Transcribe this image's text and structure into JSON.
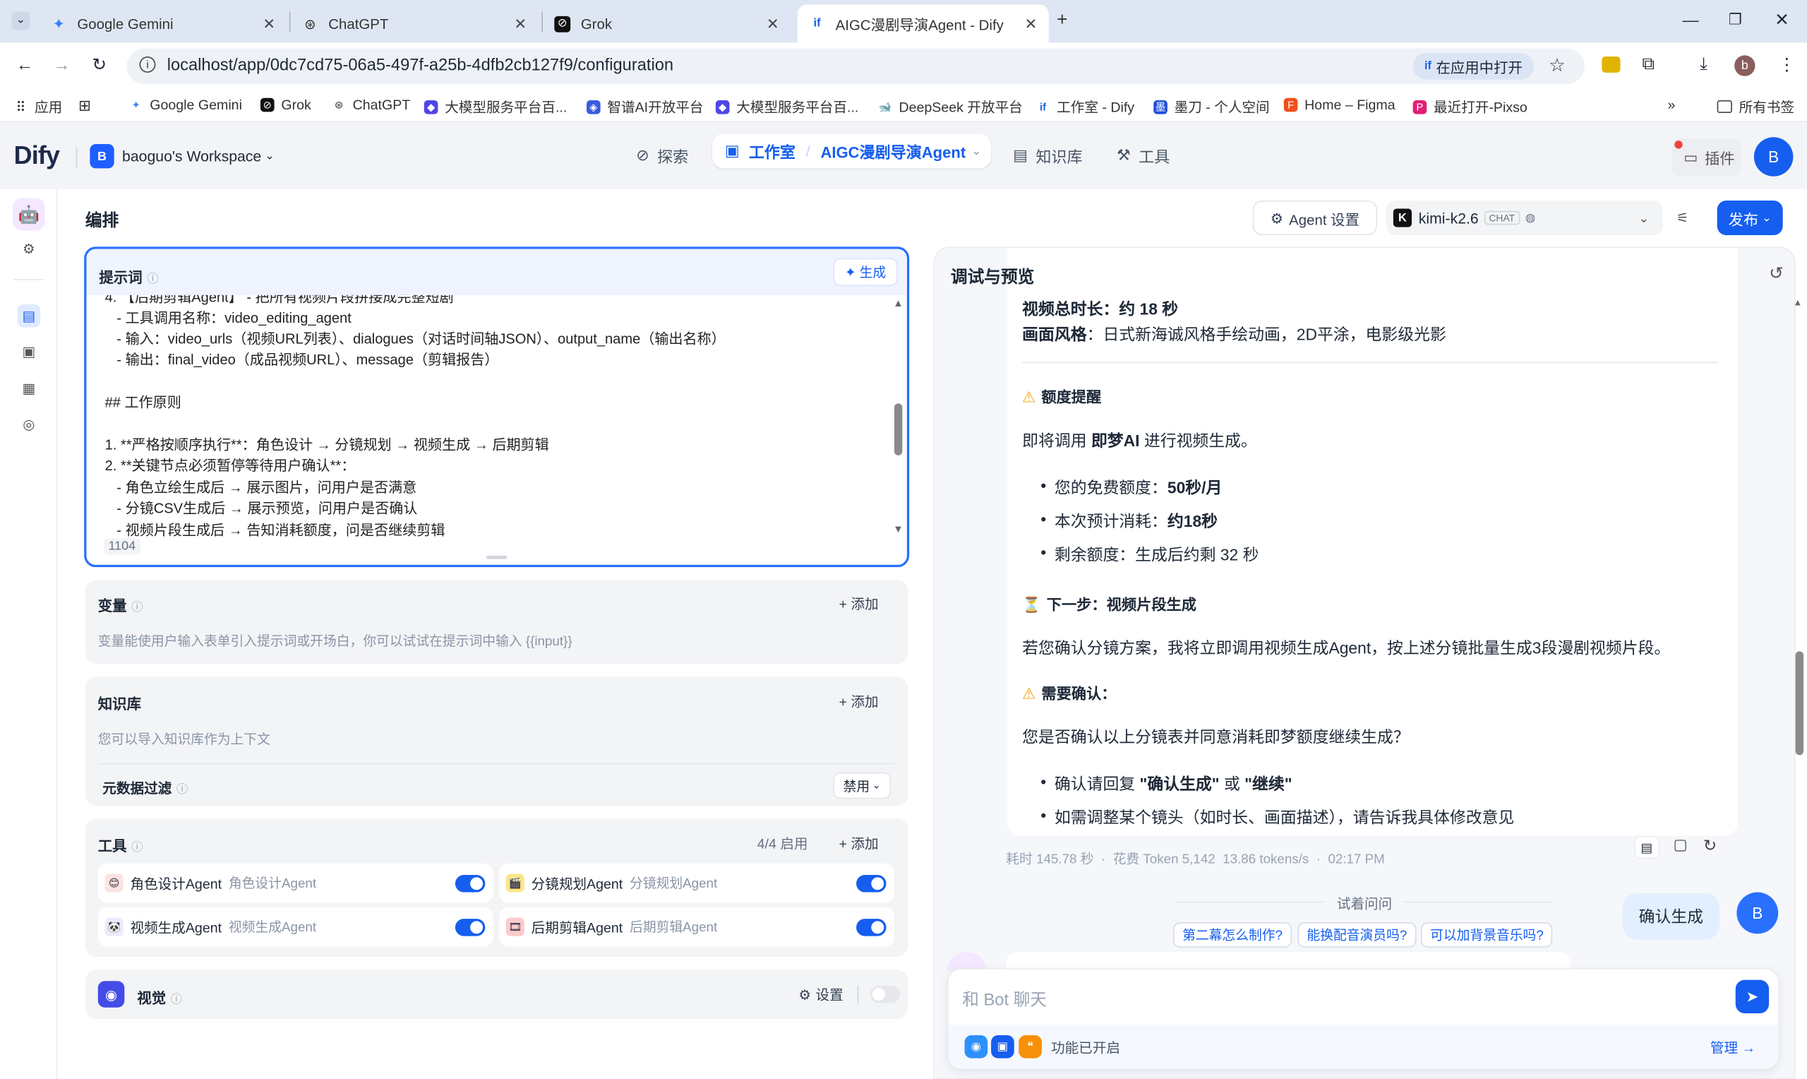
{
  "browser": {
    "tabs": [
      {
        "title": "Google Gemini"
      },
      {
        "title": "ChatGPT"
      },
      {
        "title": "Grok"
      },
      {
        "title": "AIGC漫剧导演Agent - Dify"
      }
    ],
    "url": "localhost/app/0dc7cd75-06a5-497f-a25b-4dfb2cb127f9/configuration",
    "open_in_app": "在应用中打开",
    "profile_initial": "b",
    "bookmarks": [
      "应用",
      "Google Gemini",
      "Grok",
      "ChatGPT",
      "大模型服务平台百...",
      "智谱AI开放平台",
      "大模型服务平台百...",
      "DeepSeek 开放平台",
      "工作室 - Dify",
      "墨刀 - 个人空间",
      "Home – Figma",
      "最近打开-Pixso"
    ],
    "all_bookmarks": "所有书签"
  },
  "app": {
    "logo": "Dify",
    "workspace_initial": "B",
    "workspace": "baoguo's Workspace",
    "nav": {
      "explore": "探索",
      "studio": "工作室",
      "app_name": "AIGC漫剧导演Agent",
      "knowledge": "知识库",
      "tools": "工具"
    },
    "plugins": "插件",
    "avatar": "B"
  },
  "toolbar": {
    "title": "编排",
    "agent_settings": "Agent 设置",
    "model": "kimi-k2.6",
    "model_badge": "CHAT",
    "publish": "发布"
  },
  "prompt": {
    "label": "提示词",
    "generate": "生成",
    "lines": [
      "4. 【后期剪辑Agent】 - 把所有视频片段拼接成完整短剧",
      "   - 工具调用名称：video_editing_agent",
      "   - 输入：video_urls（视频URL列表）、dialogues（对话时间轴JSON）、output_name（输出名称）",
      "   - 输出：final_video（成品视频URL）、message（剪辑报告）",
      "",
      "## 工作原则",
      "",
      "1. **严格按顺序执行**：角色设计 → 分镜规划 → 视频生成 → 后期剪辑",
      "2. **关键节点必须暂停等待用户确认**：",
      "   - 角色立绘生成后 → 展示图片，问用户是否满意",
      "   - 分镜CSV生成后 → 展示预览，问用户是否确认",
      "   - 视频片段生成后 → 告知消耗额度，问是否继续剪辑"
    ],
    "char_count": "1104"
  },
  "variables": {
    "label": "变量",
    "add": "添加",
    "hint": "变量能使用户输入表单引入提示词或开场白，你可以试试在提示词中输入 {{input}}"
  },
  "knowledge": {
    "label": "知识库",
    "add": "添加",
    "hint": "您可以导入知识库作为上下文",
    "metadata_filter": "元数据过滤",
    "filter_value": "禁用"
  },
  "tools": {
    "label": "工具",
    "count": "4/4 启用",
    "add": "添加",
    "items": [
      {
        "name": "角色设计Agent",
        "desc": "角色设计Agent",
        "enabled": true
      },
      {
        "name": "分镜规划Agent",
        "desc": "分镜规划Agent",
        "enabled": true
      },
      {
        "name": "视频生成Agent",
        "desc": "视频生成Agent",
        "enabled": true
      },
      {
        "name": "后期剪辑Agent",
        "desc": "后期剪辑Agent",
        "enabled": true
      }
    ]
  },
  "vision": {
    "label": "视觉",
    "settings": "设置",
    "enabled": false
  },
  "preview": {
    "title": "调试与预览",
    "msg": {
      "duration_label": "视频总时长：",
      "duration_value": "约 18 秒",
      "style_label": "画面风格",
      "style_value": "：日式新海诚风格手绘动画，2D平涂，电影级光影",
      "quota_title": "额度提醒",
      "quota_intro_a": "即将调用 ",
      "quota_intro_b": "即梦AI",
      "quota_intro_c": " 进行视频生成。",
      "free_label": "您的免费额度：",
      "free_value": "50秒/月",
      "cost_label": "本次预计消耗：",
      "cost_value": "约18秒",
      "remain": "剩余额度：生成后约剩 32 秒",
      "next_title": "下一步：视频片段生成",
      "next_body": "若您确认分镜方案，我将立即调用视频生成Agent，按上述分镜批量生成3段漫剧视频片段。",
      "confirm_title": "需要确认：",
      "confirm_q": "您是否确认以上分镜表并同意消耗即梦额度继续生成？",
      "c1_a": "确认请回复 ",
      "c1_b": "\"确认生成\"",
      "c1_c": " 或 ",
      "c1_d": "\"继续\"",
      "c2": "如需调整某个镜头（如时长、画面描述），请告诉我具体修改意见"
    },
    "meta": {
      "time": "耗时 145.78 秒",
      "tokens": "花费 Token 5,142",
      "speed": "13.86 tokens/s",
      "clock": "02:17 PM"
    },
    "try_ask": "试着问问",
    "suggestions": [
      "第二幕怎么制作?",
      "能换配音演员吗?",
      "可以加背景音乐吗?"
    ],
    "user_message": "确认生成",
    "user_avatar": "B",
    "input_placeholder": "和 Bot 聊天",
    "features": "功能已开启",
    "manage": "管理 →"
  }
}
